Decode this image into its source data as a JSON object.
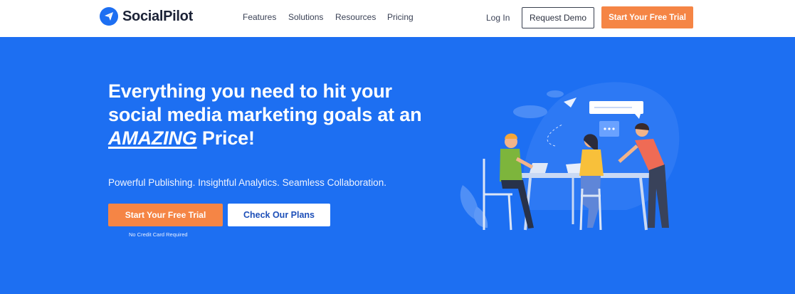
{
  "header": {
    "logo_text": "SocialPilot",
    "nav": [
      "Features",
      "Solutions",
      "Resources",
      "Pricing"
    ],
    "login_label": "Log In",
    "demo_label": "Request Demo",
    "trial_label": "Start Your Free Trial"
  },
  "hero": {
    "title_line1": "Everything you need to hit your",
    "title_line2": "social media marketing goals at an",
    "title_amazing": "AMAZING",
    "title_end": " Price!",
    "subtitle": "Powerful Publishing. Insightful Analytics. Seamless Collaboration.",
    "cta_trial": "Start Your Free Trial",
    "cta_plans": "Check Our Plans",
    "no_credit_card": "No Credit Card Required"
  },
  "colors": {
    "brand_blue": "#1d6ff2",
    "accent_orange": "#f58545"
  },
  "icons": [
    "paper-plane-logo-icon",
    "team-meeting-illustration"
  ]
}
